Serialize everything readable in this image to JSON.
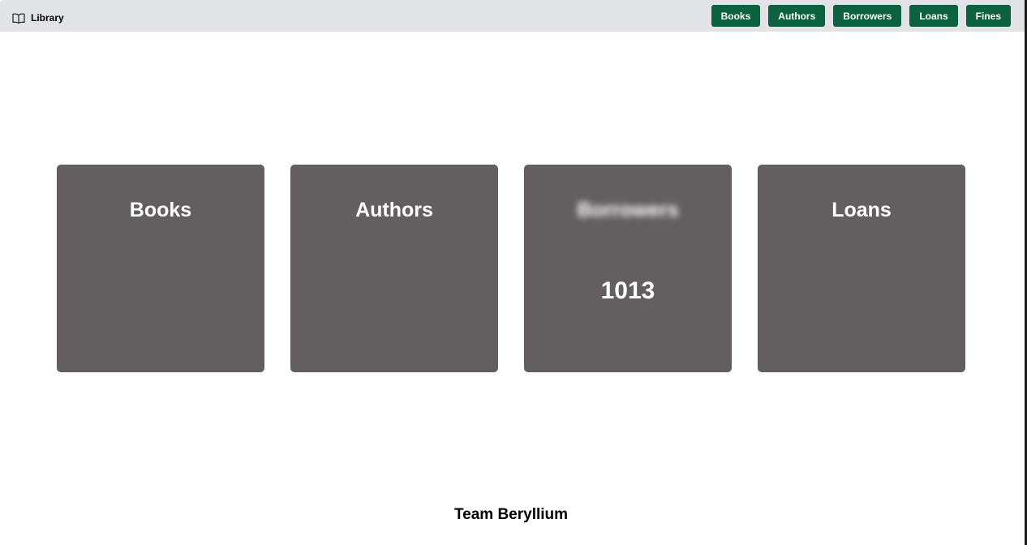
{
  "brand": {
    "icon": "open-book-icon",
    "title": "Library"
  },
  "nav": {
    "items": [
      {
        "label": "Books"
      },
      {
        "label": "Authors"
      },
      {
        "label": "Borrowers"
      },
      {
        "label": "Loans"
      },
      {
        "label": "Fines"
      }
    ]
  },
  "cards": [
    {
      "title": "Books",
      "count": ""
    },
    {
      "title": "Authors",
      "count": ""
    },
    {
      "title": "Borrowers",
      "count": "1013"
    },
    {
      "title": "Loans",
      "count": ""
    }
  ],
  "footer": {
    "text": "Team Beryllium"
  },
  "colors": {
    "navbar_bg": "#e2e3e7",
    "button_bg": "#0b6140",
    "card_bg": "#635f60",
    "text_light": "#ffffff"
  }
}
